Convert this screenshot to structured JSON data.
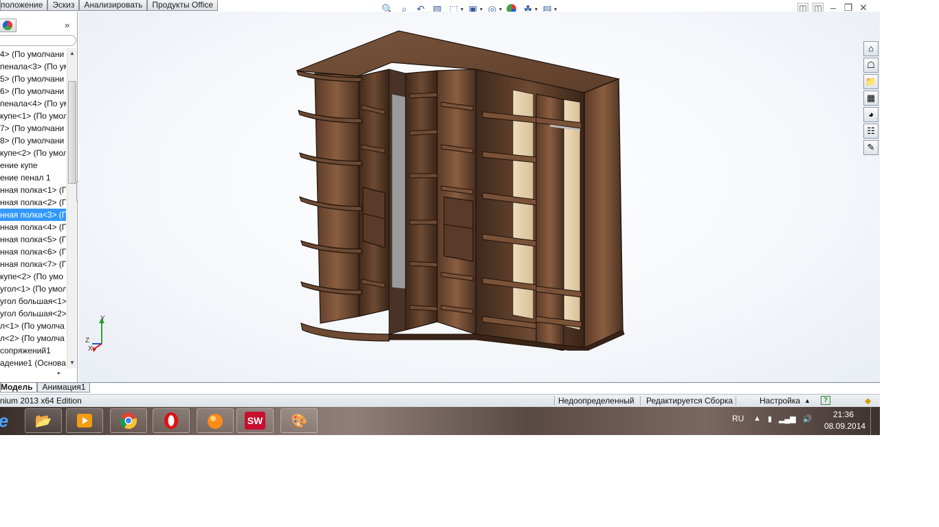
{
  "top_tabs": [
    "положение",
    "Эскиз",
    "Анализировать",
    "Продукты Office"
  ],
  "heads_up_toolbar": {
    "icons": [
      "zoom-to-fit-icon",
      "zoom-area-icon",
      "previous-view-icon",
      "section-view-icon",
      "view-orientation-icon",
      "display-style-icon",
      "hide-show-icon",
      "edit-appearance-icon",
      "apply-scene-icon",
      "view-settings-icon"
    ]
  },
  "window_controls": [
    "tile-left-icon",
    "tile-right-icon",
    "minimize-icon",
    "restore-icon",
    "close-icon"
  ],
  "feature_tree": {
    "items": [
      "4> (По умолчани",
      "пенала<3> (По ум",
      "5> (По умолчани",
      "6> (По умолчани",
      "пенала<4> (По ум",
      "купе<1> (По умол",
      "7> (По умолчани",
      "8> (По умолчани",
      "купе<2> (По умол",
      "ение купе",
      "ение пенал 1",
      "нная полка<1> (П",
      "нная полка<2> (П",
      "нная полка<3> (П",
      "нная полка<4> (П",
      "нная полка<5> (П",
      "нная полка<6> (П",
      "нная полка<7> (П",
      "купе<2> (По умо",
      "угол<1> (По умол",
      "угол большая<1>",
      "угол большая<2>",
      "л<1> (По умолча",
      "л<2> (По умолча",
      "сопряжений1",
      "адение1 (Основа"
    ],
    "selected_index": 13
  },
  "triad": {
    "y": "Y",
    "z": "Z",
    "x": "X"
  },
  "task_pane": [
    "resources-icon",
    "design-library-icon",
    "file-explorer-icon",
    "view-palette-icon",
    "appearances-icon",
    "custom-properties-icon",
    "forum-icon"
  ],
  "bottom_tabs": [
    "Модель",
    "Анимация1"
  ],
  "status_bar": {
    "edition": "nium 2013 x64 Edition",
    "definition": "Недоопределенный",
    "editing": "Редактируется Сборка",
    "settings": "Настройка",
    "help": "?"
  },
  "taskbar": {
    "apps": [
      "file-explorer-icon",
      "media-player-icon",
      "chrome-icon",
      "opera-icon",
      "games-icon",
      "solidworks-icon",
      "paint-icon"
    ],
    "solidworks_label": "SW",
    "lang": "RU",
    "time": "21:36",
    "date": "08.09.2014"
  },
  "colors": {
    "selection": "#3399ff",
    "wood_dark": "#4a3226",
    "wood_mid": "#7a5238",
    "wood_light": "#a8775a",
    "back_panel": "#e8d4b4"
  }
}
